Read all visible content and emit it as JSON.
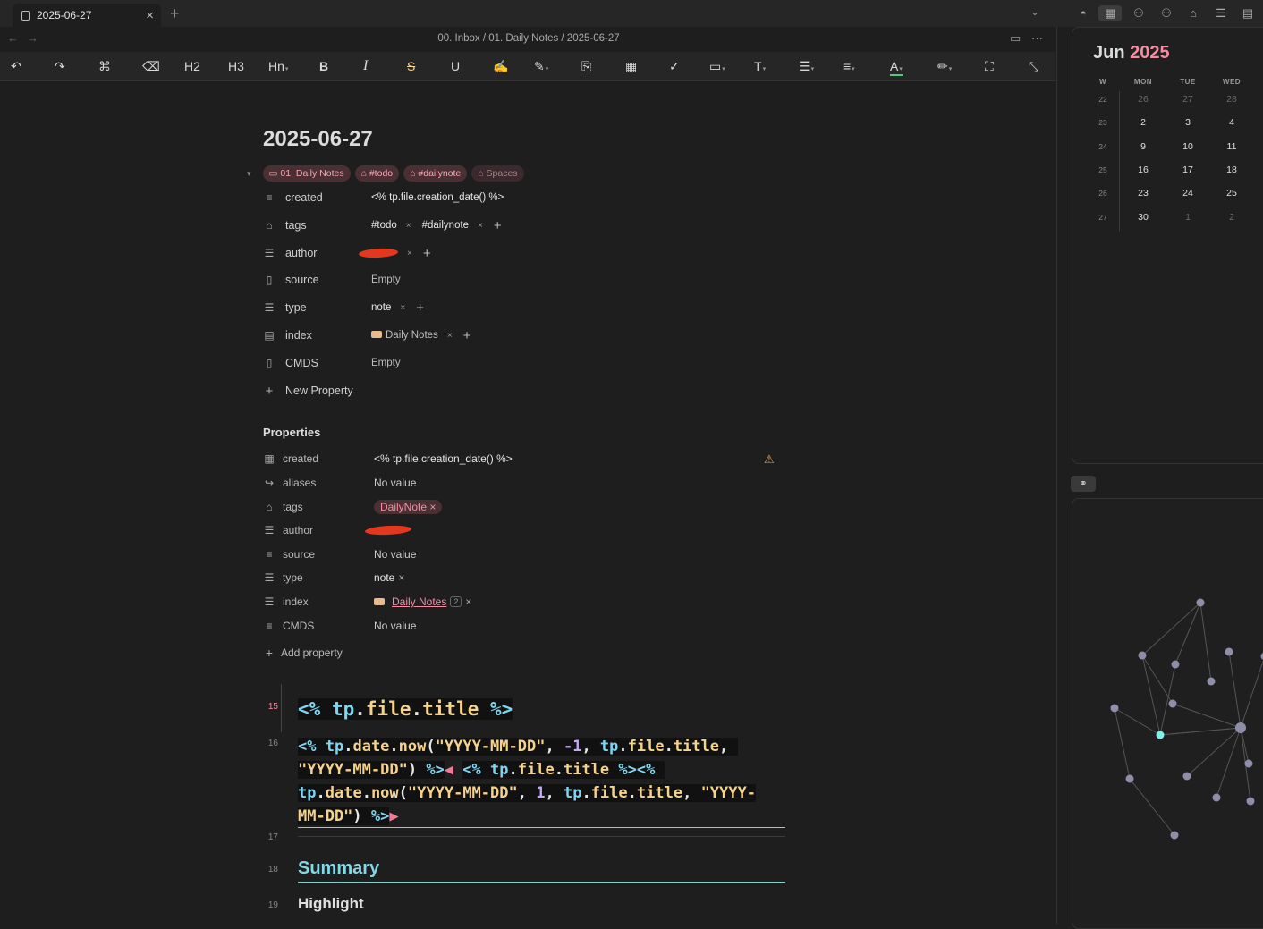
{
  "tab": {
    "title": "2025-06-27",
    "close": "×",
    "new": "+"
  },
  "breadcrumb": "00. Inbox / 01. Daily Notes / 2025-06-27",
  "toolbar": {
    "h2": "H2",
    "h3": "H3",
    "hn": "Hn",
    "bold": "B",
    "italic": "I",
    "strike": "S",
    "underline": "U"
  },
  "note": {
    "title": "2025-06-27",
    "pills": [
      "01. Daily Notes",
      "#todo",
      "#dailynote",
      "Spaces"
    ],
    "properties": [
      {
        "name": "created",
        "value": "<% tp.file.creation_date() %>"
      },
      {
        "name": "tags",
        "values": [
          "#todo",
          "#dailynote"
        ]
      },
      {
        "name": "author"
      },
      {
        "name": "source",
        "value": "Empty"
      },
      {
        "name": "type",
        "values": [
          "note"
        ]
      },
      {
        "name": "index",
        "values": [
          "Daily Notes"
        ]
      },
      {
        "name": "CMDS",
        "value": "Empty"
      }
    ],
    "new_property": "New Property"
  },
  "properties_panel": {
    "heading": "Properties",
    "rows": [
      {
        "name": "created",
        "value": "<% tp.file.creation_date() %>"
      },
      {
        "name": "aliases",
        "value": "No value"
      },
      {
        "name": "tags",
        "value": "DailyNote"
      },
      {
        "name": "author",
        "value": ""
      },
      {
        "name": "source",
        "value": "No value"
      },
      {
        "name": "type",
        "value": "note"
      },
      {
        "name": "index",
        "value": "Daily Notes",
        "count": "2"
      },
      {
        "name": "CMDS",
        "value": "No value"
      }
    ],
    "add_property": "Add property"
  },
  "code": {
    "line_numbers": [
      "15",
      "16",
      "17",
      "18",
      "19"
    ],
    "summary": "Summary",
    "highlight": "Highlight"
  },
  "calendar": {
    "month": "Jun",
    "year": "2025",
    "headers": [
      "W",
      "MON",
      "TUE",
      "WED"
    ],
    "weeks": [
      {
        "w": "22",
        "days": [
          "26",
          "27",
          "28"
        ],
        "dim": true
      },
      {
        "w": "23",
        "days": [
          "2",
          "3",
          "4"
        ]
      },
      {
        "w": "24",
        "days": [
          "9",
          "10",
          "11"
        ]
      },
      {
        "w": "25",
        "days": [
          "16",
          "17",
          "18"
        ]
      },
      {
        "w": "26",
        "days": [
          "23",
          "24",
          "25"
        ]
      },
      {
        "w": "27",
        "days": [
          "30",
          "1",
          "2"
        ],
        "dim_after_first": true
      }
    ]
  },
  "colors": {
    "accent_pink": "#f28fa3",
    "code_cyan": "#7fd6f2",
    "code_yellow": "#f5d38e",
    "graph_active": "#7ff0e8",
    "graph_node": "#8e8ea8"
  }
}
